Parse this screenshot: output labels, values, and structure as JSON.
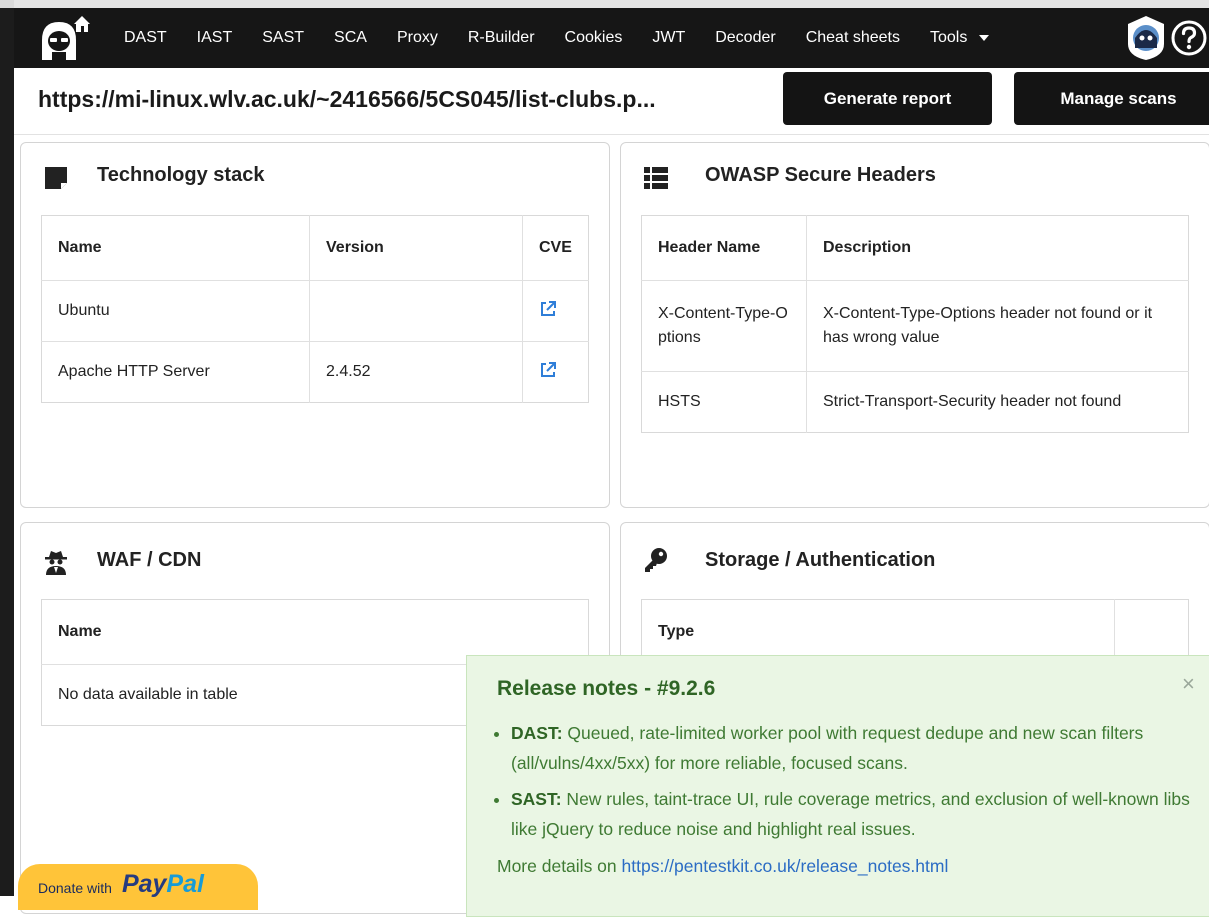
{
  "navbar": {
    "items": [
      "DAST",
      "IAST",
      "SAST",
      "SCA",
      "Proxy",
      "R-Builder",
      "Cookies",
      "JWT",
      "Decoder",
      "Cheat sheets"
    ],
    "tools_label": "Tools"
  },
  "urlbar": {
    "url": "https://mi-linux.wlv.ac.uk/~2416566/5CS045/list-clubs.p...",
    "generate_report": "Generate report",
    "manage_scans": "Manage scans"
  },
  "tech_stack": {
    "title": "Technology stack",
    "headers": [
      "Name",
      "Version",
      "CVE"
    ],
    "rows": [
      {
        "name": "Ubuntu",
        "version": ""
      },
      {
        "name": "Apache HTTP Server",
        "version": "2.4.52"
      }
    ]
  },
  "owasp": {
    "title": "OWASP Secure Headers",
    "headers": [
      "Header Name",
      "Description"
    ],
    "rows": [
      {
        "name": "X-Content-Type-Options",
        "description": "X-Content-Type-Options header not found or it has wrong value"
      },
      {
        "name": "HSTS",
        "description": "Strict-Transport-Security header not found"
      }
    ]
  },
  "waf": {
    "title": "WAF / CDN",
    "headers": [
      "Name"
    ],
    "empty": "No data available in table"
  },
  "storage": {
    "title": "Storage / Authentication",
    "headers": [
      "Type",
      ""
    ]
  },
  "release_notes": {
    "title": "Release notes - #9.2.6",
    "close": "×",
    "items": [
      {
        "label": "DAST:",
        "text": " Queued, rate-limited worker pool with request dedupe and new scan filters (all/vulns/4xx/5xx) for more reliable, focused scans."
      },
      {
        "label": "SAST:",
        "text": " New rules, taint-trace UI, rule coverage metrics, and exclusion of well-known libs like jQuery to reduce noise and highlight real issues."
      }
    ],
    "more_prefix": "More details on ",
    "more_link": "https://pentestkit.co.uk/release_notes.html"
  },
  "donate": {
    "label": "Donate with",
    "brand_part1": "Pay",
    "brand_part2": "Pal"
  },
  "colors": {
    "navbar_bg": "#161616",
    "button_bg": "#141414",
    "release_bg": "#eaf6e4",
    "release_text": "#3f7a33",
    "link": "#2b6cc4",
    "paypal_yellow": "#ffc439"
  },
  "icons": [
    "hacker-home-logo-icon",
    "hacker-mascot-icon",
    "help-circle-icon",
    "sticky-note-icon",
    "list-icon",
    "spy-icon",
    "key-icon",
    "external-link-icon",
    "close-icon"
  ]
}
